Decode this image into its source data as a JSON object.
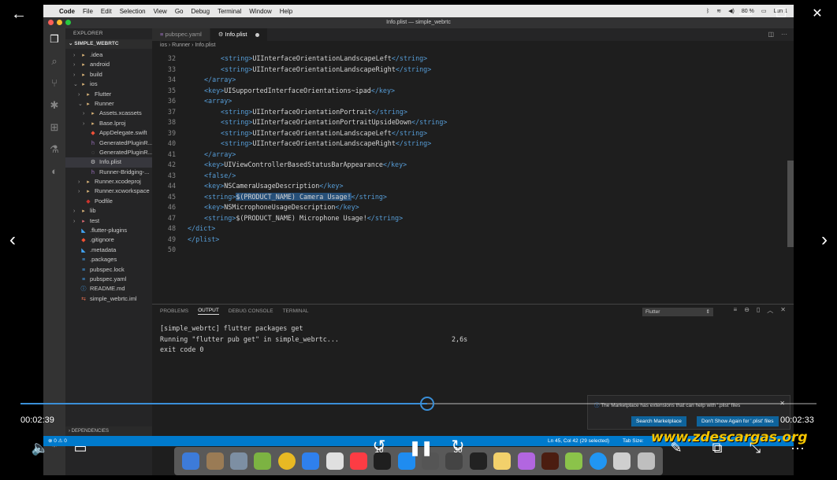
{
  "menubar": {
    "items": [
      "Code",
      "File",
      "Edit",
      "Selection",
      "View",
      "Go",
      "Debug",
      "Terminal",
      "Window",
      "Help"
    ],
    "battery": "80 %",
    "clock": "Lun 1"
  },
  "window": {
    "title": "Info.plist — simple_webrtc"
  },
  "sidebar": {
    "title": "EXPLORER",
    "project": "SIMPLE_WEBRTC",
    "items": [
      {
        "label": ".idea",
        "depth": 1,
        "chev": "›",
        "icon": "folder"
      },
      {
        "label": "android",
        "depth": 1,
        "chev": "›",
        "icon": "folder"
      },
      {
        "label": "build",
        "depth": 1,
        "chev": "›",
        "icon": "folder"
      },
      {
        "label": "ios",
        "depth": 1,
        "chev": "⌄",
        "icon": "folder"
      },
      {
        "label": "Flutter",
        "depth": 2,
        "chev": "›",
        "icon": "folder"
      },
      {
        "label": "Runner",
        "depth": 2,
        "chev": "⌄",
        "icon": "folder"
      },
      {
        "label": "Assets.xcassets",
        "depth": 3,
        "chev": "›",
        "icon": "folder"
      },
      {
        "label": "Base.lproj",
        "depth": 3,
        "chev": "›",
        "icon": "folder"
      },
      {
        "label": "AppDelegate.swift",
        "depth": 3,
        "chev": "",
        "icon": "swift"
      },
      {
        "label": "GeneratedPluginR...",
        "depth": 3,
        "chev": "",
        "icon": "h"
      },
      {
        "label": "GeneratedPluginR...",
        "depth": 3,
        "chev": "",
        "icon": "c"
      },
      {
        "label": "Info.plist",
        "depth": 3,
        "chev": "",
        "icon": "gear",
        "selected": true
      },
      {
        "label": "Runner-Bridging-...",
        "depth": 3,
        "chev": "",
        "icon": "h"
      },
      {
        "label": "Runner.xcodeproj",
        "depth": 2,
        "chev": "›",
        "icon": "folder"
      },
      {
        "label": "Runner.xcworkspace",
        "depth": 2,
        "chev": "›",
        "icon": "folder"
      },
      {
        "label": "Podfile",
        "depth": 2,
        "chev": "",
        "icon": "ruby"
      },
      {
        "label": "lib",
        "depth": 1,
        "chev": "›",
        "icon": "folder"
      },
      {
        "label": "test",
        "depth": 1,
        "chev": "›",
        "icon": "test"
      },
      {
        "label": ".flutter-plugins",
        "depth": 1,
        "chev": "",
        "icon": "flutter"
      },
      {
        "label": ".gitignore",
        "depth": 1,
        "chev": "",
        "icon": "git"
      },
      {
        "label": ".metadata",
        "depth": 1,
        "chev": "",
        "icon": "flutter"
      },
      {
        "label": ".packages",
        "depth": 1,
        "chev": "",
        "icon": "file"
      },
      {
        "label": "pubspec.lock",
        "depth": 1,
        "chev": "",
        "icon": "file"
      },
      {
        "label": "pubspec.yaml",
        "depth": 1,
        "chev": "",
        "icon": "file"
      },
      {
        "label": "README.md",
        "depth": 1,
        "chev": "",
        "icon": "md"
      },
      {
        "label": "simple_webrtc.iml",
        "depth": 1,
        "chev": "",
        "icon": "iml"
      }
    ],
    "dependencies": "DEPENDENCIES"
  },
  "tabs": [
    {
      "label": "pubspec.yaml",
      "active": false
    },
    {
      "label": "Info.plist",
      "active": true
    }
  ],
  "breadcrumb": "ios › Runner › Info.plist",
  "editor": {
    "lines": [
      {
        "n": "32",
        "indent": 4,
        "parts": [
          [
            "t",
            "<string>"
          ],
          [
            "x",
            "UIInterfaceOrientationLandscapeLeft"
          ],
          [
            "t",
            "</string>"
          ]
        ]
      },
      {
        "n": "33",
        "indent": 4,
        "parts": [
          [
            "t",
            "<string>"
          ],
          [
            "x",
            "UIInterfaceOrientationLandscapeRight"
          ],
          [
            "t",
            "</string>"
          ]
        ]
      },
      {
        "n": "34",
        "indent": 2,
        "parts": [
          [
            "t",
            "</array>"
          ]
        ]
      },
      {
        "n": "35",
        "indent": 2,
        "parts": [
          [
            "t",
            "<key>"
          ],
          [
            "x",
            "UISupportedInterfaceOrientations~ipad"
          ],
          [
            "t",
            "</key>"
          ]
        ]
      },
      {
        "n": "36",
        "indent": 2,
        "parts": [
          [
            "t",
            "<array>"
          ]
        ]
      },
      {
        "n": "37",
        "indent": 4,
        "parts": [
          [
            "t",
            "<string>"
          ],
          [
            "x",
            "UIInterfaceOrientationPortrait"
          ],
          [
            "t",
            "</string>"
          ]
        ]
      },
      {
        "n": "38",
        "indent": 4,
        "parts": [
          [
            "t",
            "<string>"
          ],
          [
            "x",
            "UIInterfaceOrientationPortraitUpsideDown"
          ],
          [
            "t",
            "</string>"
          ]
        ]
      },
      {
        "n": "39",
        "indent": 4,
        "parts": [
          [
            "t",
            "<string>"
          ],
          [
            "x",
            "UIInterfaceOrientationLandscapeLeft"
          ],
          [
            "t",
            "</string>"
          ]
        ]
      },
      {
        "n": "40",
        "indent": 4,
        "parts": [
          [
            "t",
            "<string>"
          ],
          [
            "x",
            "UIInterfaceOrientationLandscapeRight"
          ],
          [
            "t",
            "</string>"
          ]
        ]
      },
      {
        "n": "41",
        "indent": 2,
        "parts": [
          [
            "t",
            "</array>"
          ]
        ]
      },
      {
        "n": "42",
        "indent": 2,
        "parts": [
          [
            "t",
            "<key>"
          ],
          [
            "x",
            "UIViewControllerBasedStatusBarAppearance"
          ],
          [
            "t",
            "</key>"
          ]
        ]
      },
      {
        "n": "43",
        "indent": 2,
        "parts": [
          [
            "t",
            "<false/>"
          ]
        ]
      },
      {
        "n": "44",
        "indent": 2,
        "parts": [
          [
            "t",
            "<key>"
          ],
          [
            "x",
            "NSCameraUsageDescription"
          ],
          [
            "t",
            "</key>"
          ]
        ]
      },
      {
        "n": "45",
        "indent": 2,
        "parts": [
          [
            "t",
            "<string>"
          ],
          [
            "h",
            "$(PRODUCT_NAME) Camera Usage!"
          ],
          [
            "t",
            "</string>"
          ]
        ]
      },
      {
        "n": "46",
        "indent": 2,
        "parts": [
          [
            "t",
            "<key>"
          ],
          [
            "x",
            "NSMicrophoneUsageDescription"
          ],
          [
            "t",
            "</key>"
          ]
        ]
      },
      {
        "n": "47",
        "indent": 2,
        "parts": [
          [
            "t",
            "<string>"
          ],
          [
            "x",
            "$(PRODUCT_NAME) Microphone Usage!"
          ],
          [
            "t",
            "</string>"
          ]
        ]
      },
      {
        "n": "48",
        "indent": 0,
        "parts": [
          [
            "t",
            "</dict>"
          ]
        ]
      },
      {
        "n": "49",
        "indent": 0,
        "parts": [
          [
            "t",
            "</plist>"
          ]
        ]
      },
      {
        "n": "50",
        "indent": 0,
        "parts": []
      }
    ]
  },
  "panel": {
    "tabs": [
      {
        "label": "PROBLEMS",
        "active": false
      },
      {
        "label": "OUTPUT",
        "active": true
      },
      {
        "label": "DEBUG CONSOLE",
        "active": false
      },
      {
        "label": "TERMINAL",
        "active": false
      }
    ],
    "channel": "Flutter",
    "output": [
      {
        "text": "[simple_webrtc] flutter packages get",
        "time": ""
      },
      {
        "text": "Running \"flutter pub get\" in simple_webrtc...",
        "time": "2,6s"
      },
      {
        "text": "exit code 0",
        "time": ""
      }
    ]
  },
  "notification": {
    "message": "The Marketplace has extensions that can help with '.plist' files",
    "button_search": "Search Marketplace",
    "button_dont": "Don't Show Again for '.plist' files"
  },
  "statusbar": {
    "position": "Ln 45, Col 42 (29 selected)",
    "tab_size": "Tab Size:"
  },
  "player": {
    "time_elapsed": "00:02:39",
    "time_remaining": "00:02:33",
    "progress": 0.511,
    "skip_back": "10",
    "skip_forward": "30",
    "watermark": "www.zdescargas.org"
  },
  "colors": {
    "accent": "#3a8fd8",
    "vscode_blue": "#007acc",
    "tag": "#569cd6",
    "watermark": "#f5c400"
  }
}
